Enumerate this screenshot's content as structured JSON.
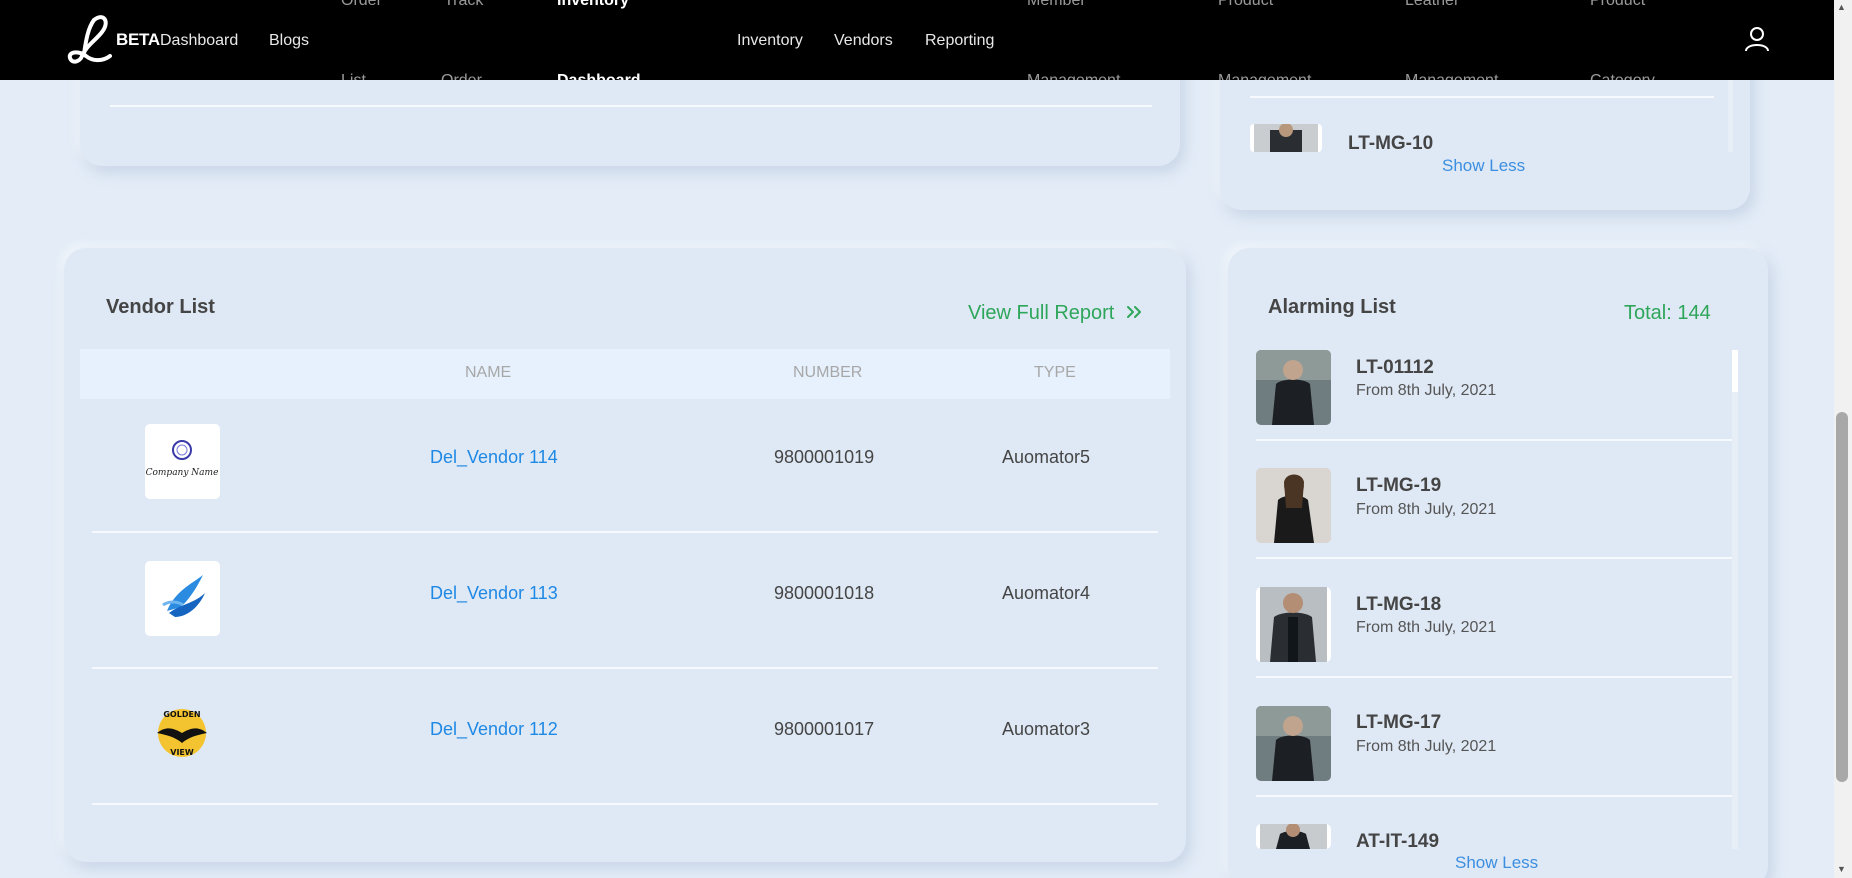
{
  "nav": {
    "brand_badge": "BETA",
    "items": {
      "dashboard": "Dashboard",
      "blogs": "Blogs",
      "order_top": "Order",
      "order_list_bottom": "List",
      "track_top": "Track",
      "track_bottom": "Order",
      "inventory_dashboard_top": "Inventory",
      "inventory_dashboard_bottom": "Dashboard",
      "inventory": "Inventory",
      "vendors": "Vendors",
      "reporting": "Reporting",
      "member_top": "Member",
      "member_bottom": "Management",
      "product_top": "Product",
      "product_bottom": "Management",
      "leather_top": "Leather",
      "leather_bottom": "Management",
      "product_cat_top": "Product",
      "product_cat_bottom": "Category"
    }
  },
  "top_right_card": {
    "item_code": "LT-MG-10",
    "show_less": "Show Less"
  },
  "vendor_list": {
    "title": "Vendor List",
    "view_full_report": "View Full Report",
    "columns": {
      "name": "NAME",
      "number": "NUMBER",
      "type": "TYPE"
    },
    "rows": [
      {
        "logo": "company-name-logo",
        "logo_text": "Company Name",
        "name": "Del_Vendor 114",
        "number": "9800001019",
        "type": "Auomator5"
      },
      {
        "logo": "blue-wing-logo",
        "name": "Del_Vendor 113",
        "number": "9800001018",
        "type": "Auomator4"
      },
      {
        "logo": "golden-view-logo",
        "logo_text_top": "GOLDEN",
        "logo_text_bottom": "VIEW",
        "name": "Del_Vendor 112",
        "number": "9800001017",
        "type": "Auomator3"
      }
    ]
  },
  "alarming_list": {
    "title": "Alarming List",
    "total": "Total: 144",
    "items": [
      {
        "code": "LT-01112",
        "date": "From 8th July, 2021"
      },
      {
        "code": "LT-MG-19",
        "date": "From 8th July, 2021"
      },
      {
        "code": "LT-MG-18",
        "date": "From 8th July, 2021"
      },
      {
        "code": "LT-MG-17",
        "date": "From 8th July, 2021"
      },
      {
        "code": "AT-IT-149"
      }
    ],
    "show_less": "Show Less"
  },
  "colors": {
    "nav_bg": "#000000",
    "page_bg": "#e3ecf7",
    "link_blue": "#1e88e5",
    "total_green": "#2ea65a"
  }
}
